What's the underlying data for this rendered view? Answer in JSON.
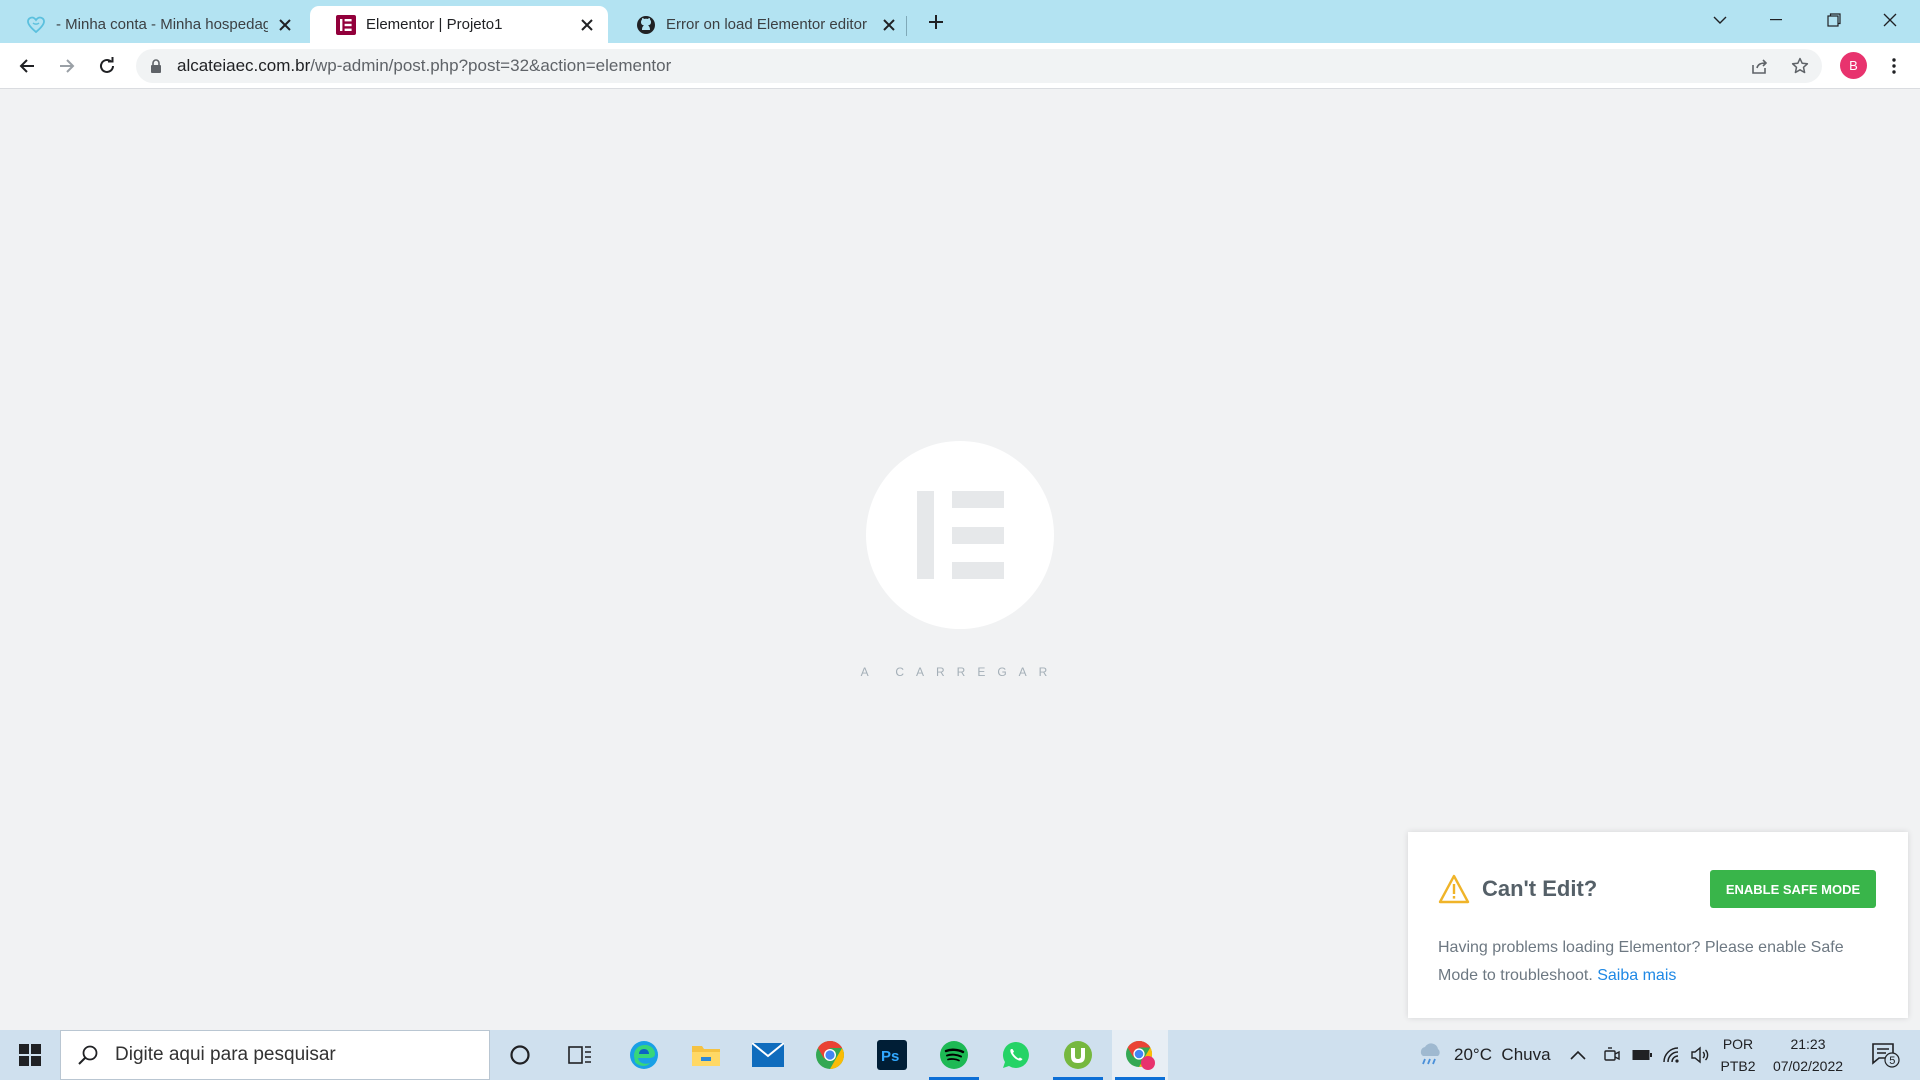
{
  "browser": {
    "tabs": [
      {
        "title": "- Minha conta - Minha hospedagem",
        "favicon": "hostinger-heart-icon",
        "active": false
      },
      {
        "title": "Elementor | Projeto1",
        "favicon": "elementor-icon",
        "active": true
      },
      {
        "title": "Error on load Elementor editor · Issue",
        "favicon": "github-icon",
        "active": false
      }
    ],
    "url_host": "alcateiaec.com.br",
    "url_path": "/wp-admin/post.php?post=32&action=elementor",
    "profile_initial": "B"
  },
  "page": {
    "loading_text": "A CARREGAR",
    "colors": {
      "background": "#f1f2f3",
      "logo": "#e6e8ea",
      "loader_text": "#a4afb7"
    }
  },
  "dialog": {
    "title": "Can't Edit?",
    "button_label": "ENABLE SAFE MODE",
    "message": "Having problems loading Elementor? Please enable Safe Mode to troubleshoot.",
    "link_label": "Saiba mais",
    "colors": {
      "button": "#39b54a",
      "link": "#1e88e5",
      "warning": "#f0b429"
    }
  },
  "taskbar": {
    "search_placeholder": "Digite aqui para pesquisar",
    "weather": "20°C  Chuva",
    "language_top": "POR",
    "language_bottom": "PTB2",
    "time": "21:23",
    "date": "07/02/2022",
    "notification_count": "5",
    "apps": [
      "cortana-icon",
      "task-view-icon",
      "edge-icon",
      "file-explorer-icon",
      "mail-icon",
      "chrome-icon",
      "photoshop-icon",
      "spotify-icon",
      "whatsapp-icon",
      "utorrent-icon",
      "chrome-profile-icon"
    ],
    "photoshop_label": "Ps"
  }
}
